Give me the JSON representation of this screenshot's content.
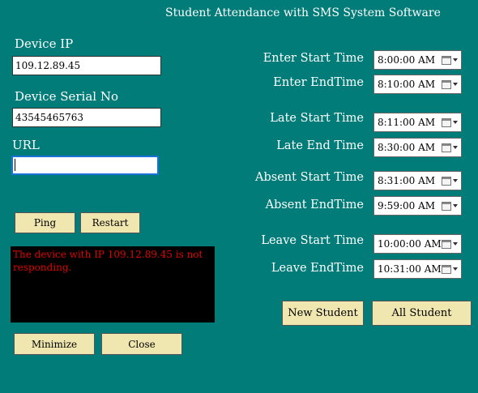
{
  "window": {
    "title": "Student Attendance with SMS System Software"
  },
  "device": {
    "ip_label": "Device IP",
    "ip_value": "109.12.89.45",
    "serial_label": "Device Serial No",
    "serial_value": "43545465763",
    "url_label": "URL",
    "url_value": ""
  },
  "actions": {
    "ping": "Ping",
    "restart": "Restart",
    "minimize": "Minimize",
    "close": "Close",
    "new_student": "New Student",
    "all_student": "All Student"
  },
  "status_message": "The device with IP 109.12.89.45 is not responding.",
  "times": {
    "enter_start": {
      "label": "Enter Start Time",
      "value": "8:00:00 AM"
    },
    "enter_end": {
      "label": "Enter EndTime",
      "value": "8:10:00 AM"
    },
    "late_start": {
      "label": "Late Start Time",
      "value": "8:11:00 AM"
    },
    "late_end": {
      "label": "Late End Time",
      "value": "8:30:00 AM"
    },
    "absent_start": {
      "label": "Absent Start Time",
      "value": "8:31:00 AM"
    },
    "absent_end": {
      "label": "Absent EndTime",
      "value": "9:59:00 AM"
    },
    "leave_start": {
      "label": "Leave Start Time",
      "value": "10:00:00 AM"
    },
    "leave_end": {
      "label": "Leave EndTime",
      "value": "10:31:00 AM"
    }
  },
  "colors": {
    "background": "#017c78",
    "button": "#f0e6b0",
    "message_text": "#e00000"
  },
  "icons": {
    "time_picker": "calendar-icon",
    "dropdown": "chevron-down-icon"
  }
}
